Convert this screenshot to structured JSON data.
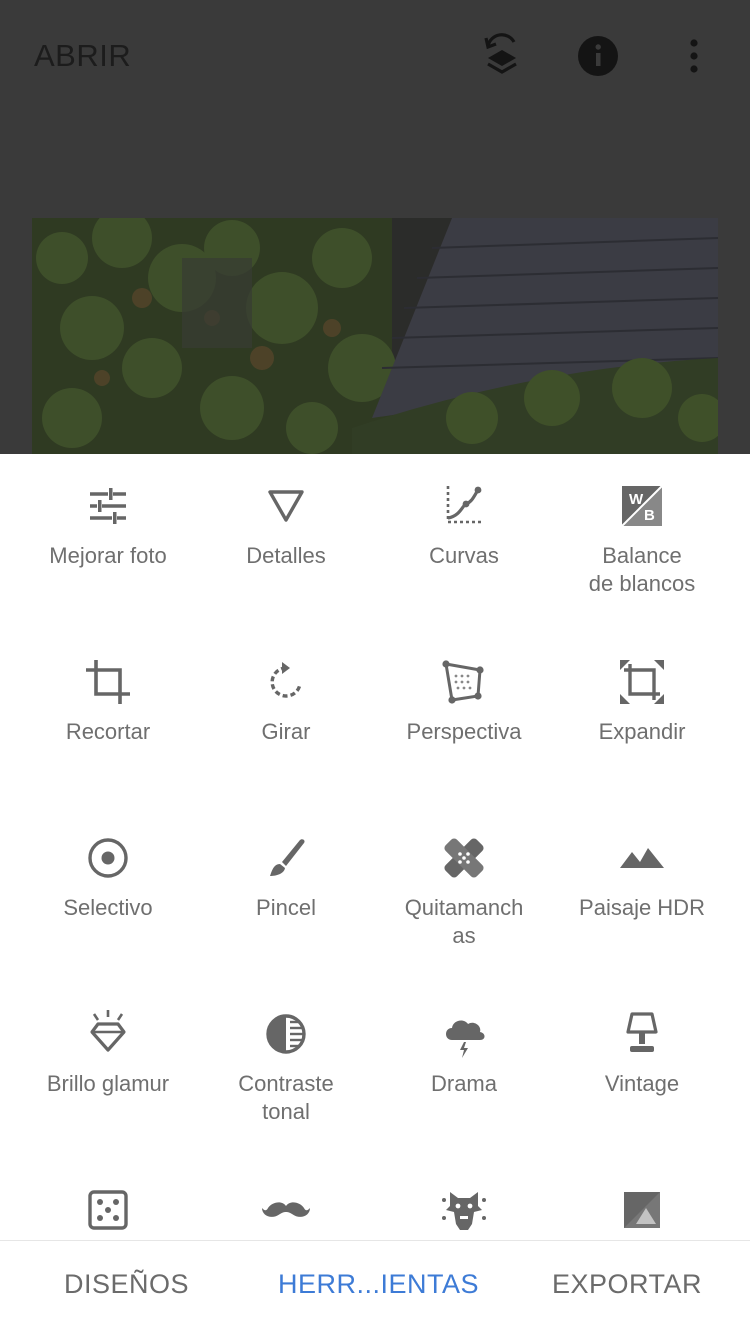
{
  "header": {
    "open_label": "ABRIR",
    "icons": [
      "layers-history-icon",
      "info-icon",
      "more-vert-icon"
    ]
  },
  "tools": [
    {
      "label": "Mejorar foto",
      "icon": "tune-sliders-icon"
    },
    {
      "label": "Detalles",
      "icon": "triangle-details-icon"
    },
    {
      "label": "Curvas",
      "icon": "curves-icon"
    },
    {
      "label": "Balance\nde blancos",
      "icon": "white-balance-icon"
    },
    {
      "label": "Recortar",
      "icon": "crop-icon"
    },
    {
      "label": "Girar",
      "icon": "rotate-icon"
    },
    {
      "label": "Perspectiva",
      "icon": "perspective-icon"
    },
    {
      "label": "Expandir",
      "icon": "expand-icon"
    },
    {
      "label": "Selectivo",
      "icon": "selective-icon"
    },
    {
      "label": "Pincel",
      "icon": "brush-icon"
    },
    {
      "label": "Quitamanch\nas",
      "icon": "healing-icon"
    },
    {
      "label": "Paisaje HDR",
      "icon": "hdr-landscape-icon"
    },
    {
      "label": "Brillo glamur",
      "icon": "glamour-glow-icon"
    },
    {
      "label": "Contraste\ntonal",
      "icon": "tonal-contrast-icon"
    },
    {
      "label": "Drama",
      "icon": "drama-cloud-icon"
    },
    {
      "label": "Vintage",
      "icon": "vintage-lamp-icon"
    },
    {
      "label": "",
      "icon": "grainy-film-icon"
    },
    {
      "label": "",
      "icon": "mustache-icon"
    },
    {
      "label": "",
      "icon": "grunge-icon"
    },
    {
      "label": "",
      "icon": "black-white-icon"
    }
  ],
  "bottom_bar": {
    "designs": "DISEÑOS",
    "tools": "HERR...IENTAS",
    "export": "EXPORTAR"
  },
  "colors": {
    "accent": "#3d7bd6",
    "icon": "#666666",
    "label": "#6f6f6f",
    "overlay": "#3a3a3a"
  }
}
